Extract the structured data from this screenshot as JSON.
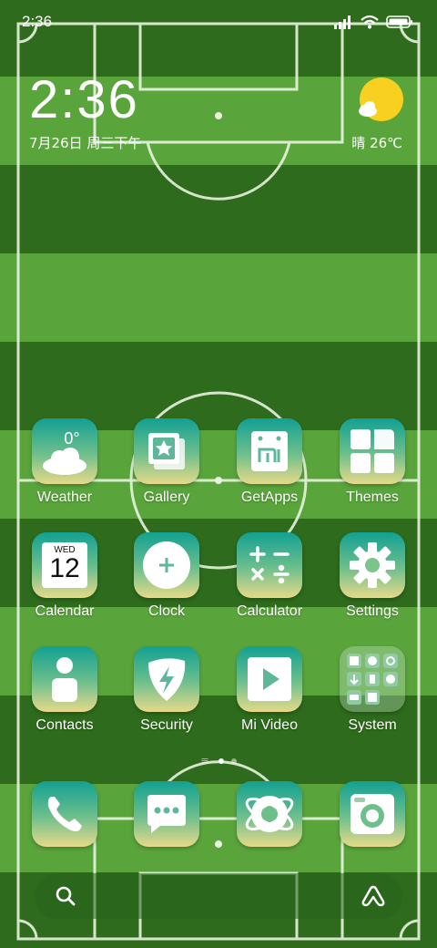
{
  "status_bar": {
    "time": "2:36"
  },
  "clock_widget": {
    "time": "2:36",
    "date": "7月26日 周三下午"
  },
  "weather_widget": {
    "condition": "晴",
    "temperature": "26℃",
    "icon": "sun-cloud-icon"
  },
  "apps": {
    "row1": [
      {
        "label": "Weather",
        "icon": "weather-cloud-icon",
        "temp": "0°"
      },
      {
        "label": "Gallery",
        "icon": "gallery-star-icon"
      },
      {
        "label": "GetApps",
        "icon": "getapps-mi-icon"
      },
      {
        "label": "Themes",
        "icon": "themes-grid-icon"
      }
    ],
    "row2": [
      {
        "label": "Calendar",
        "icon": "calendar-icon",
        "day": "WED",
        "date": "12"
      },
      {
        "label": "Clock",
        "icon": "clock-icon"
      },
      {
        "label": "Calculator",
        "icon": "calculator-icon"
      },
      {
        "label": "Settings",
        "icon": "gear-icon"
      }
    ],
    "row3": [
      {
        "label": "Contacts",
        "icon": "contacts-person-icon"
      },
      {
        "label": "Security",
        "icon": "security-shield-icon"
      },
      {
        "label": "Mi Video",
        "icon": "video-play-icon"
      },
      {
        "label": "System",
        "icon": "folder-icon"
      }
    ]
  },
  "dock": [
    {
      "icon": "phone-icon"
    },
    {
      "icon": "messages-icon"
    },
    {
      "icon": "browser-icon"
    },
    {
      "icon": "camera-icon"
    }
  ],
  "page_indicator": {
    "pages": 2,
    "active": 0
  },
  "colors": {
    "stripe_dark": "#2e6b1c",
    "stripe_light": "#58a23a",
    "icon_top": "#12a092",
    "icon_bottom": "#e6d98a"
  }
}
